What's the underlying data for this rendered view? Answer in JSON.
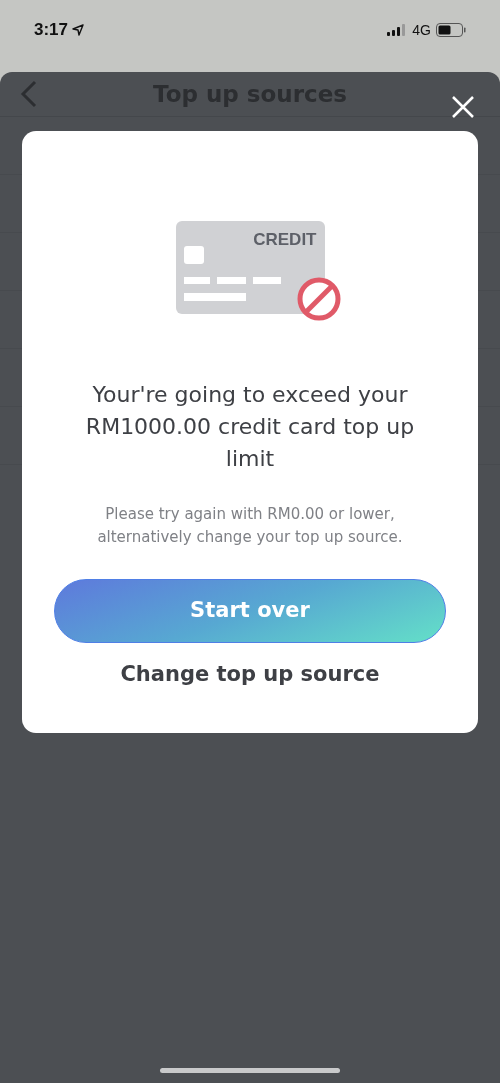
{
  "status_bar": {
    "time": "3:17",
    "network": "4G"
  },
  "header": {
    "title": "Top up sources"
  },
  "dialog": {
    "card_label": "CREDIT",
    "title": "Your're going to exceed your RM1000.00 credit card top up limit",
    "message": "Please try again with RM0.00 or lower, alternatively change your top up source.",
    "primary_button": "Start over",
    "secondary_button": "Change top up source"
  }
}
